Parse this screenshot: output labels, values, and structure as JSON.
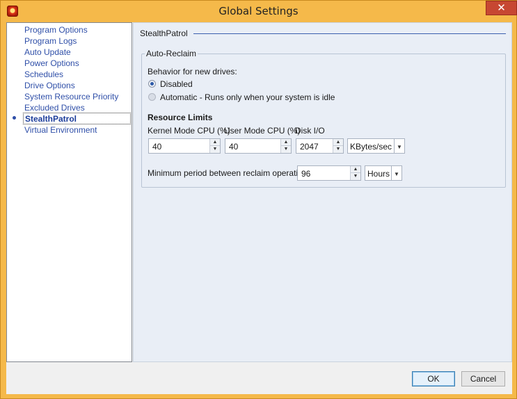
{
  "window": {
    "title": "Global Settings",
    "close_glyph": "✕",
    "app_icon": "app-logo-icon"
  },
  "nav": {
    "items": [
      {
        "label": "Program Options"
      },
      {
        "label": "Program Logs"
      },
      {
        "label": "Auto Update"
      },
      {
        "label": "Power Options"
      },
      {
        "label": "Schedules"
      },
      {
        "label": "Drive Options"
      },
      {
        "label": "System Resource Priority"
      },
      {
        "label": "Excluded Drives"
      },
      {
        "label": "StealthPatrol",
        "selected": true
      },
      {
        "label": "Virtual Environment"
      }
    ]
  },
  "panel": {
    "header": "StealthPatrol",
    "group_title": "Auto-Reclaim",
    "behavior_label": "Behavior for new drives:",
    "radio_disabled": "Disabled",
    "radio_automatic": "Automatic - Runs only when your system is idle",
    "resource_limits": "Resource Limits",
    "kernel_label": "Kernel Mode CPU (%)",
    "user_label": "User Mode CPU (%)",
    "disk_label": "Disk I/O",
    "kernel_value": "40",
    "user_value": "40",
    "disk_value": "2047",
    "disk_unit": "KBytes/sec",
    "period_label": "Minimum period between reclaim operations",
    "period_value": "96",
    "period_unit": "Hours"
  },
  "buttons": {
    "ok": "OK",
    "cancel": "Cancel"
  },
  "colors": {
    "frame": "#f5b94a",
    "accent": "#2f4fa8",
    "content_bg": "#e9eef6"
  }
}
